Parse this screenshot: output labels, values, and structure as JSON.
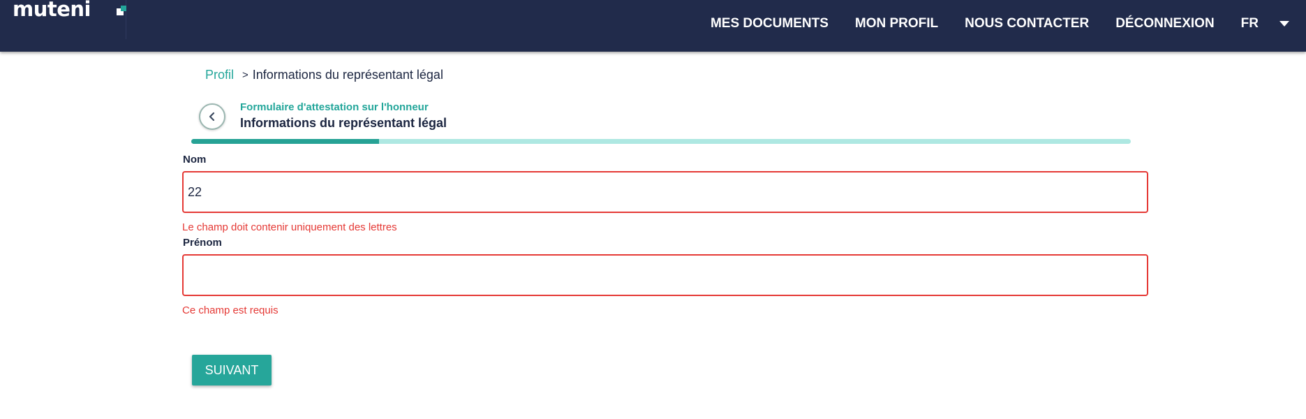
{
  "header": {
    "logo_text": "muteni",
    "nav": [
      "MES DOCUMENTS",
      "MON PROFIL",
      "NOUS CONTACTER",
      "DÉCONNEXION"
    ],
    "language": "FR",
    "background_color": "#212b4b",
    "logo_accent_color": "#23a69a"
  },
  "breadcrumb": {
    "link": "Profil",
    "separator": ">",
    "current": "Informations du représentant légal"
  },
  "form_header": {
    "back_icon": "chevron-left-icon",
    "subtitle": "Formulaire d'attestation sur l'honneur",
    "title": "Informations du représentant légal"
  },
  "progress": {
    "value": 0.2,
    "fill_color": "#26a295",
    "track_color": "#aee8e2"
  },
  "fields": {
    "nom": {
      "label": "Nom",
      "value": "22",
      "error": "Le champ doit contenir uniquement des lettres"
    },
    "prenom": {
      "label": "Prénom",
      "value": "",
      "error": "Ce champ est requis"
    }
  },
  "submit_label": "SUIVANT",
  "colors": {
    "accent": "#26a69a",
    "error": "#e53935",
    "text_dark": "#1b2540"
  }
}
